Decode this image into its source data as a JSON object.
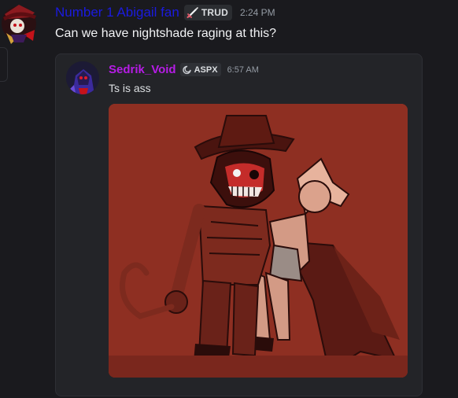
{
  "message": {
    "author": "Number 1 Abigail fan",
    "tag": {
      "label": "TRUD",
      "icon": "sword-icon"
    },
    "timestamp": "2:24 PM",
    "text": "Can we have nightshade raging at this?",
    "username_color": "#1b1bdf"
  },
  "forwarded": {
    "author": "Sedrik_Void",
    "tag": {
      "label": "ASPX",
      "icon": "crescent-icon"
    },
    "timestamp": "6:57 AM",
    "text": "Ts is ass",
    "username_color": "#b61ce6",
    "image": {
      "alt": "red toned drawing of a cowboy-hat skeleton with a hook hand carrying a caped figure"
    }
  }
}
